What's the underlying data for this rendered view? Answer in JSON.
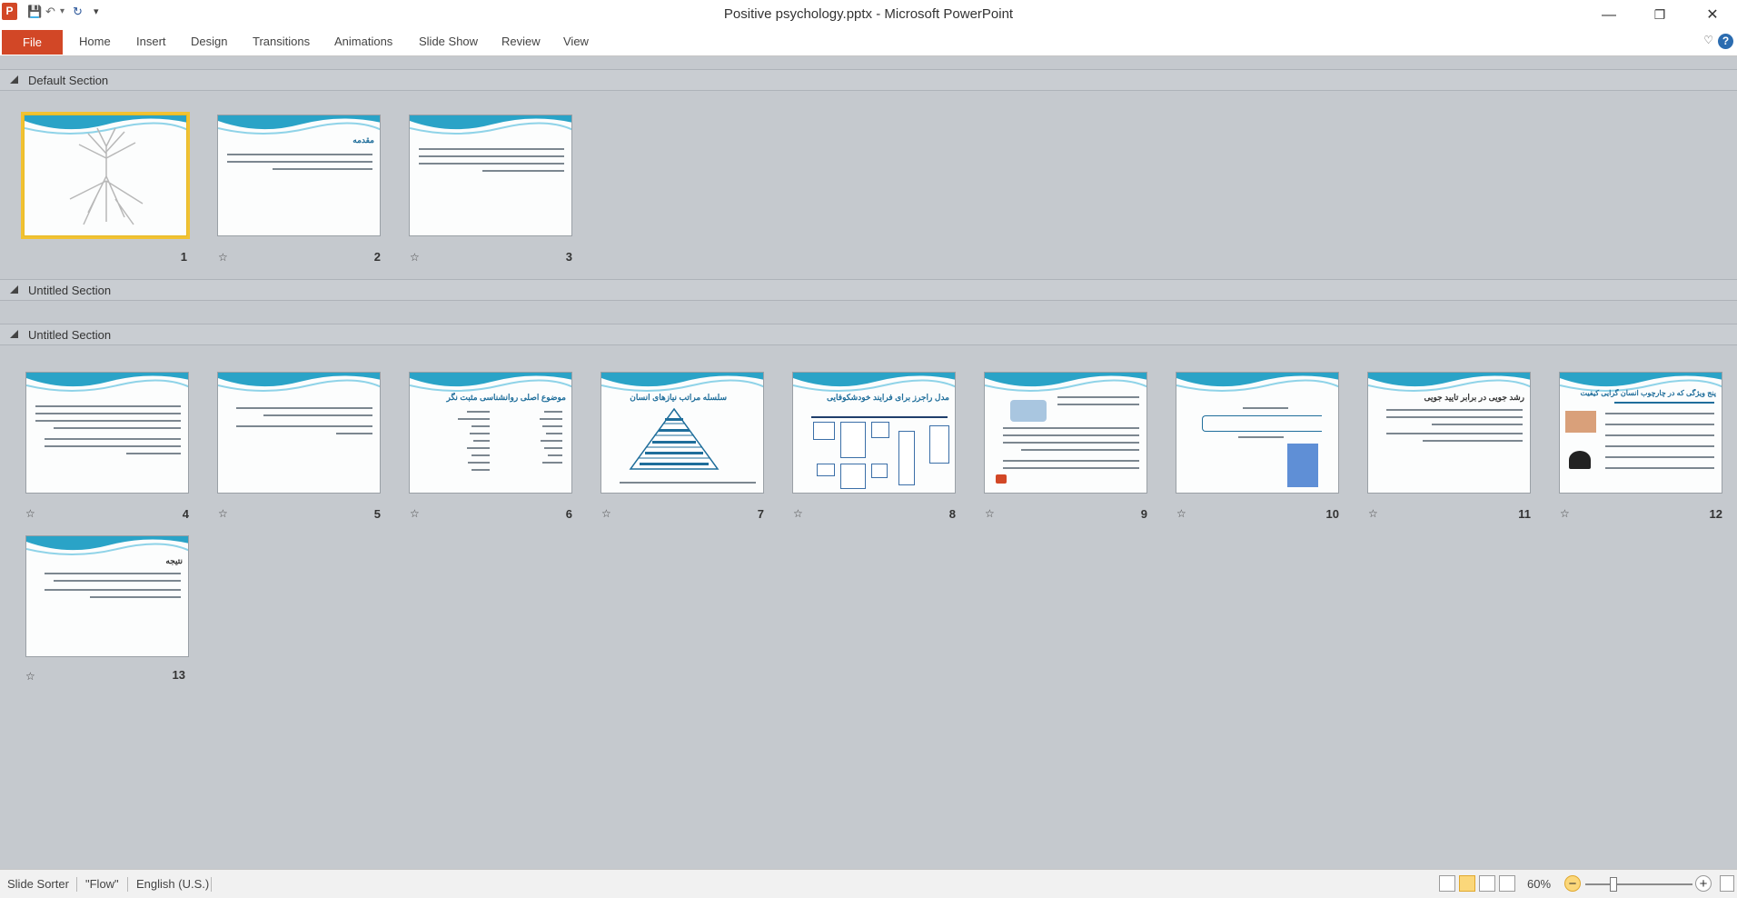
{
  "window": {
    "title": "Positive psychology.pptx  -  Microsoft PowerPoint",
    "app_icon": "P",
    "minimize": "—",
    "restore": "❐",
    "close": "✕"
  },
  "qat": {
    "save_icon": "💾",
    "undo_icon": "↶",
    "undo_dropdown": "▾",
    "redo_icon": "↻",
    "customize_icon": "▾"
  },
  "ribbon": {
    "file_label": "File",
    "tabs": [
      "Home",
      "Insert",
      "Design",
      "Transitions",
      "Animations",
      "Slide Show",
      "Review",
      "View"
    ],
    "minimize_icon": "♡",
    "help_icon": "?"
  },
  "sections": [
    {
      "name": "Default Section"
    },
    {
      "name": "Untitled Section"
    },
    {
      "name": "Untitled Section"
    }
  ],
  "slides": [
    {
      "number": "1",
      "title": "",
      "selected": true,
      "has_transition": false
    },
    {
      "number": "2",
      "title": "مقدمه",
      "has_transition": true
    },
    {
      "number": "3",
      "title": "",
      "has_transition": true
    },
    {
      "number": "4",
      "title": "",
      "has_transition": true
    },
    {
      "number": "5",
      "title": "",
      "has_transition": true
    },
    {
      "number": "6",
      "title": "موضوع اصلی روانشناسی مثبت نگر",
      "has_transition": true
    },
    {
      "number": "7",
      "title": "سلسله مراتب نیازهای انسان",
      "has_transition": true
    },
    {
      "number": "8",
      "title": "مدل راجرز برای فرایند خودشکوفایی",
      "has_transition": true
    },
    {
      "number": "9",
      "title": "",
      "has_transition": true
    },
    {
      "number": "10",
      "title": "",
      "has_transition": true
    },
    {
      "number": "11",
      "title": "رشد جویی در برابر تایید جویی",
      "has_transition": true
    },
    {
      "number": "12",
      "title": "پنج ویژگی که در چارچوب انسان گرایی کیفیت",
      "has_transition": true
    },
    {
      "number": "13",
      "title": "نتیجه",
      "has_transition": true
    }
  ],
  "transition_icon": "☆",
  "statusbar": {
    "view": "Slide Sorter",
    "theme": "\"Flow\"",
    "language": "English (U.S.)",
    "zoom": "60%",
    "zoom_minus": "−",
    "zoom_plus": "+"
  },
  "colors": {
    "file_tab": "#d24726",
    "selected_outline": "#f1c232",
    "wave": "#2aa3c7"
  }
}
